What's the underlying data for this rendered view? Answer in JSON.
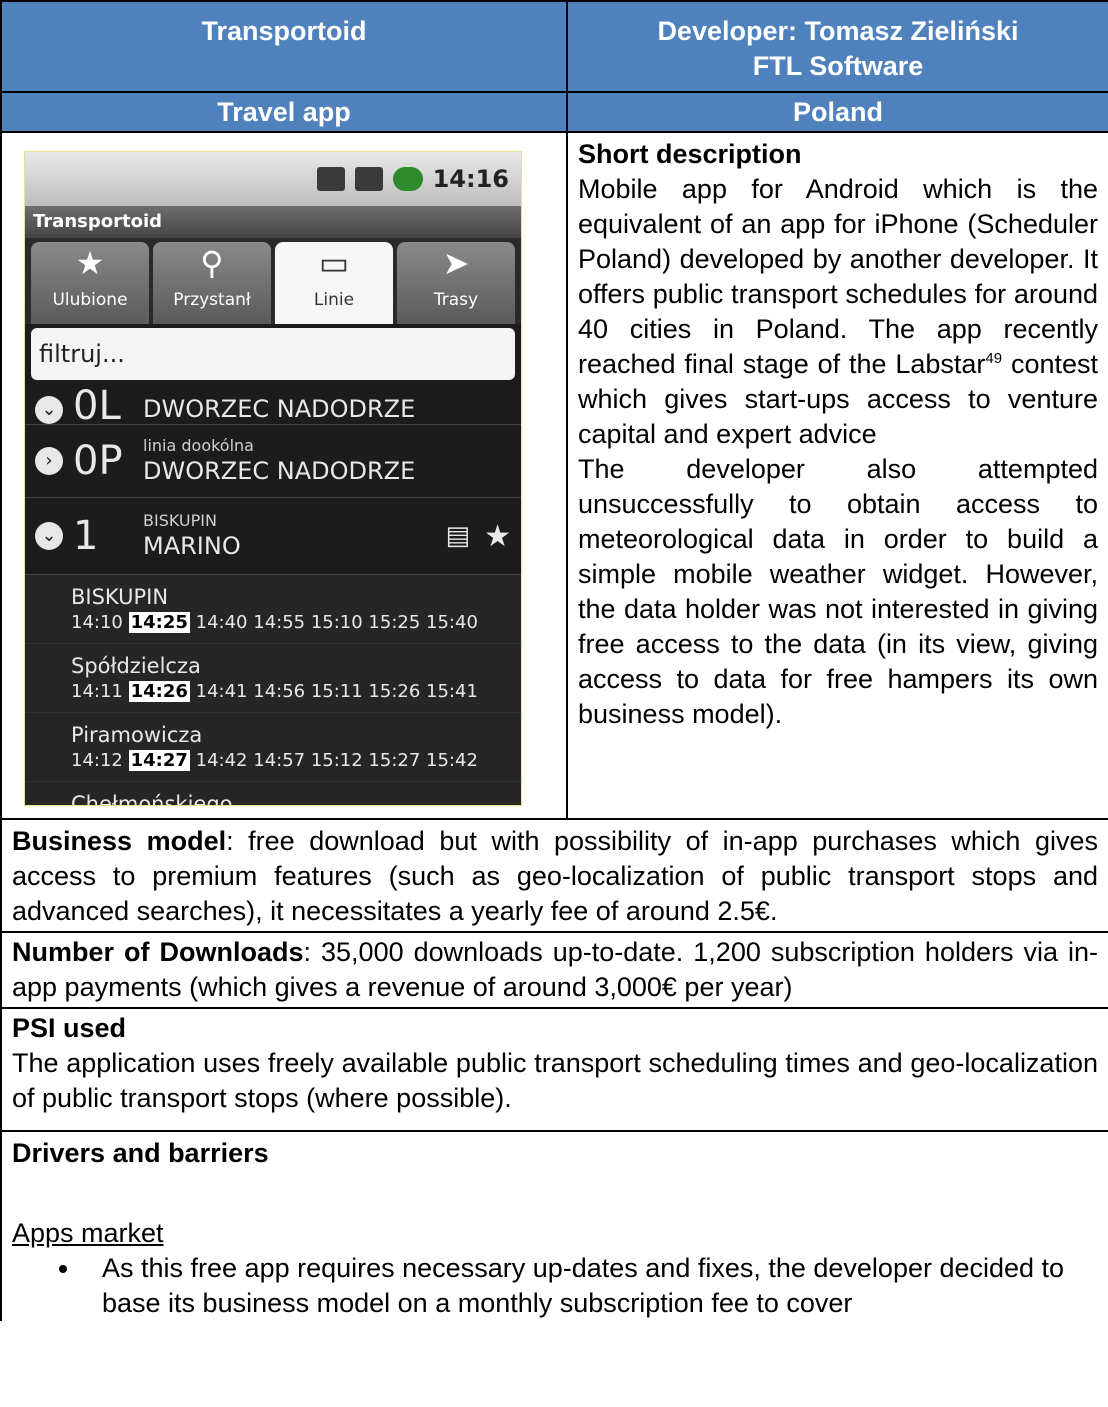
{
  "header": {
    "app_name": "Transportoid",
    "developer_line1": "Developer: Tomasz  Zieliński",
    "developer_line2": "FTL Software",
    "category": "Travel app",
    "country": "Poland"
  },
  "screenshot": {
    "status_time": "14:16",
    "app_title": "Transportoid",
    "tabs": [
      "Ulubione",
      "Przystanł",
      "Linie",
      "Trasy"
    ],
    "filter_placeholder": "filtruj...",
    "lines": [
      {
        "num": "0L",
        "sub": "",
        "name": "DWORZEC NADODRZE"
      },
      {
        "num": "0P",
        "sub": "linia dookólna",
        "name": "DWORZEC NADODRZE"
      },
      {
        "num": "1",
        "sub": "BISKUPIN",
        "name": "MARINO"
      }
    ],
    "stops": [
      {
        "name": "BISKUPIN",
        "t0": "14:10",
        "hl": "14:25",
        "rest": "14:40 14:55 15:10 15:25 15:40"
      },
      {
        "name": "Spółdzielcza",
        "t0": "14:11",
        "hl": "14:26",
        "rest": "14:41 14:56 15:11 15:26 15:41"
      },
      {
        "name": "Piramowicza",
        "t0": "14:12",
        "hl": "14:27",
        "rest": "14:42 14:57 15:12 15:27 15:42"
      },
      {
        "name": "Chełmońskiego"
      }
    ]
  },
  "description": {
    "heading": "Short description",
    "body_1": "Mobile app for Android which is the equivalent of an app for iPhone (Scheduler Poland) developed by another developer. It offers public transport schedules for around 40 cities in Poland. The app recently reached final stage of the Labstar",
    "footnote": "49",
    "body_2": " contest which gives start-ups access to venture capital and expert advice",
    "body_3": "The developer also attempted unsuccessfully to obtain access to meteorological data in order to build a simple mobile weather widget. However, the data holder was not interested in giving free access to the data (in its view, giving access to data for free hampers its own business model)."
  },
  "business": {
    "label": "Business model",
    "text": ": free download but with possibility of in-app purchases which gives access to premium features (such as geo-localization of public transport stops and advanced searches), it necessitates a yearly fee of around 2.5€."
  },
  "downloads": {
    "label": "Number of Downloads",
    "text": ": 35,000 downloads up-to-date. 1,200 subscription holders via in-app payments (which gives a revenue of around 3,000€ per year)"
  },
  "psi": {
    "heading": "PSI used",
    "text": "The application uses freely available public transport scheduling times and geo-localization of public transport stops (where possible)."
  },
  "drivers": {
    "heading": "Drivers and barriers",
    "subheading": "Apps market",
    "bullet_1": "As this free app requires necessary up-dates and fixes, the developer decided to base its business model on a monthly subscription fee to cover"
  }
}
